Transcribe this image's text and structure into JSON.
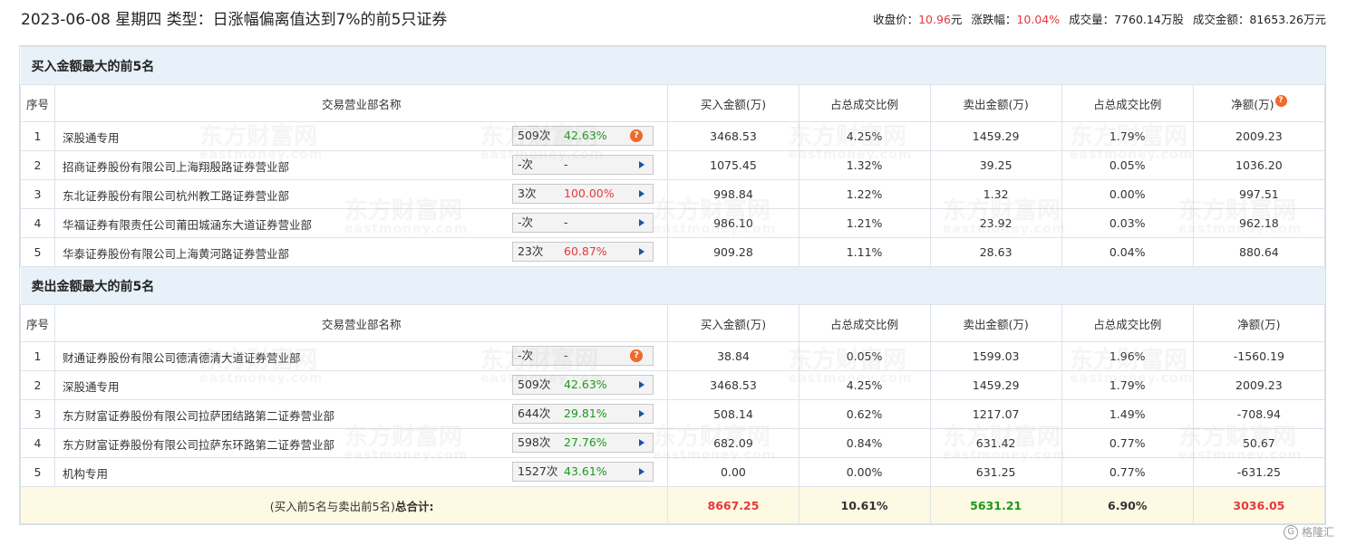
{
  "header": {
    "title": "2023-06-08 星期四 类型：日涨幅偏离值达到7%的前5只证券",
    "close_label": "收盘价：",
    "close_value": "10.96",
    "close_unit": "元",
    "change_label": "涨跌幅：",
    "change_value": "10.04%",
    "volume_label": "成交量：",
    "volume_value": "7760.14万股",
    "amount_label": "成交金额：",
    "amount_value": "81653.26万元"
  },
  "columns": [
    "序号",
    "交易营业部名称",
    "买入金额(万)",
    "占总成交比例",
    "卖出金额(万)",
    "占总成交比例",
    "净额(万)"
  ],
  "help_glyph": "?",
  "buy_section": {
    "title": "买入金额最大的前5名",
    "rows": [
      {
        "no": "1",
        "name": "深股通专用",
        "count": "509次",
        "pct": "42.63%",
        "pct_color": "green",
        "help": true,
        "buy": "3468.53",
        "buy_ratio": "4.25%",
        "sell": "1459.29",
        "sell_ratio": "1.79%",
        "net": "2009.23",
        "net_color": "red"
      },
      {
        "no": "2",
        "name": "招商证券股份有限公司上海翔殷路证券营业部",
        "count": "-次",
        "pct": "-",
        "pct_color": "plain",
        "help": false,
        "buy": "1075.45",
        "buy_ratio": "1.32%",
        "sell": "39.25",
        "sell_ratio": "0.05%",
        "net": "1036.20",
        "net_color": "red"
      },
      {
        "no": "3",
        "name": "东北证券股份有限公司杭州教工路证券营业部",
        "count": "3次",
        "pct": "100.00%",
        "pct_color": "red",
        "help": false,
        "buy": "998.84",
        "buy_ratio": "1.22%",
        "sell": "1.32",
        "sell_ratio": "0.00%",
        "net": "997.51",
        "net_color": "red"
      },
      {
        "no": "4",
        "name": "华福证券有限责任公司莆田城涵东大道证券营业部",
        "count": "-次",
        "pct": "-",
        "pct_color": "plain",
        "help": false,
        "buy": "986.10",
        "buy_ratio": "1.21%",
        "sell": "23.92",
        "sell_ratio": "0.03%",
        "net": "962.18",
        "net_color": "red"
      },
      {
        "no": "5",
        "name": "华泰证券股份有限公司上海黄河路证券营业部",
        "count": "23次",
        "pct": "60.87%",
        "pct_color": "red",
        "help": false,
        "buy": "909.28",
        "buy_ratio": "1.11%",
        "sell": "28.63",
        "sell_ratio": "0.04%",
        "net": "880.64",
        "net_color": "red"
      }
    ]
  },
  "sell_section": {
    "title": "卖出金额最大的前5名",
    "rows": [
      {
        "no": "1",
        "name": "财通证券股份有限公司德清德清大道证券营业部",
        "count": "-次",
        "pct": "-",
        "pct_color": "plain",
        "help": true,
        "buy": "38.84",
        "buy_ratio": "0.05%",
        "sell": "1599.03",
        "sell_ratio": "1.96%",
        "net": "-1560.19",
        "net_color": "green"
      },
      {
        "no": "2",
        "name": "深股通专用",
        "count": "509次",
        "pct": "42.63%",
        "pct_color": "green",
        "help": false,
        "buy": "3468.53",
        "buy_ratio": "4.25%",
        "sell": "1459.29",
        "sell_ratio": "1.79%",
        "net": "2009.23",
        "net_color": "red"
      },
      {
        "no": "3",
        "name": "东方财富证券股份有限公司拉萨团结路第二证券营业部",
        "count": "644次",
        "pct": "29.81%",
        "pct_color": "green",
        "help": false,
        "buy": "508.14",
        "buy_ratio": "0.62%",
        "sell": "1217.07",
        "sell_ratio": "1.49%",
        "net": "-708.94",
        "net_color": "green"
      },
      {
        "no": "4",
        "name": "东方财富证券股份有限公司拉萨东环路第二证券营业部",
        "count": "598次",
        "pct": "27.76%",
        "pct_color": "green",
        "help": false,
        "buy": "682.09",
        "buy_ratio": "0.84%",
        "sell": "631.42",
        "sell_ratio": "0.77%",
        "net": "50.67",
        "net_color": "red"
      },
      {
        "no": "5",
        "name": "机构专用",
        "count": "1527次",
        "pct": "43.61%",
        "pct_color": "green",
        "help": false,
        "buy": "0.00",
        "buy_ratio": "0.00%",
        "sell": "631.25",
        "sell_ratio": "0.77%",
        "net": "-631.25",
        "net_color": "green"
      }
    ]
  },
  "total": {
    "label_prefix": "(买入前5名与卖出前5名)",
    "label_bold": "总合计:",
    "buy": "8667.25",
    "buy_ratio": "10.61%",
    "sell": "5631.21",
    "sell_ratio": "6.90%",
    "net": "3036.05"
  },
  "watermark": {
    "cn": "东方财富网",
    "en": "eastmoney.com"
  },
  "logo": {
    "glyph": "G",
    "text": "格隆汇"
  },
  "colors": {
    "red": "#e4393c",
    "green": "#1a9a1a",
    "section_bg": "#e8f1fa",
    "total_bg": "#fdf9e2",
    "accent": "#f0682a"
  }
}
